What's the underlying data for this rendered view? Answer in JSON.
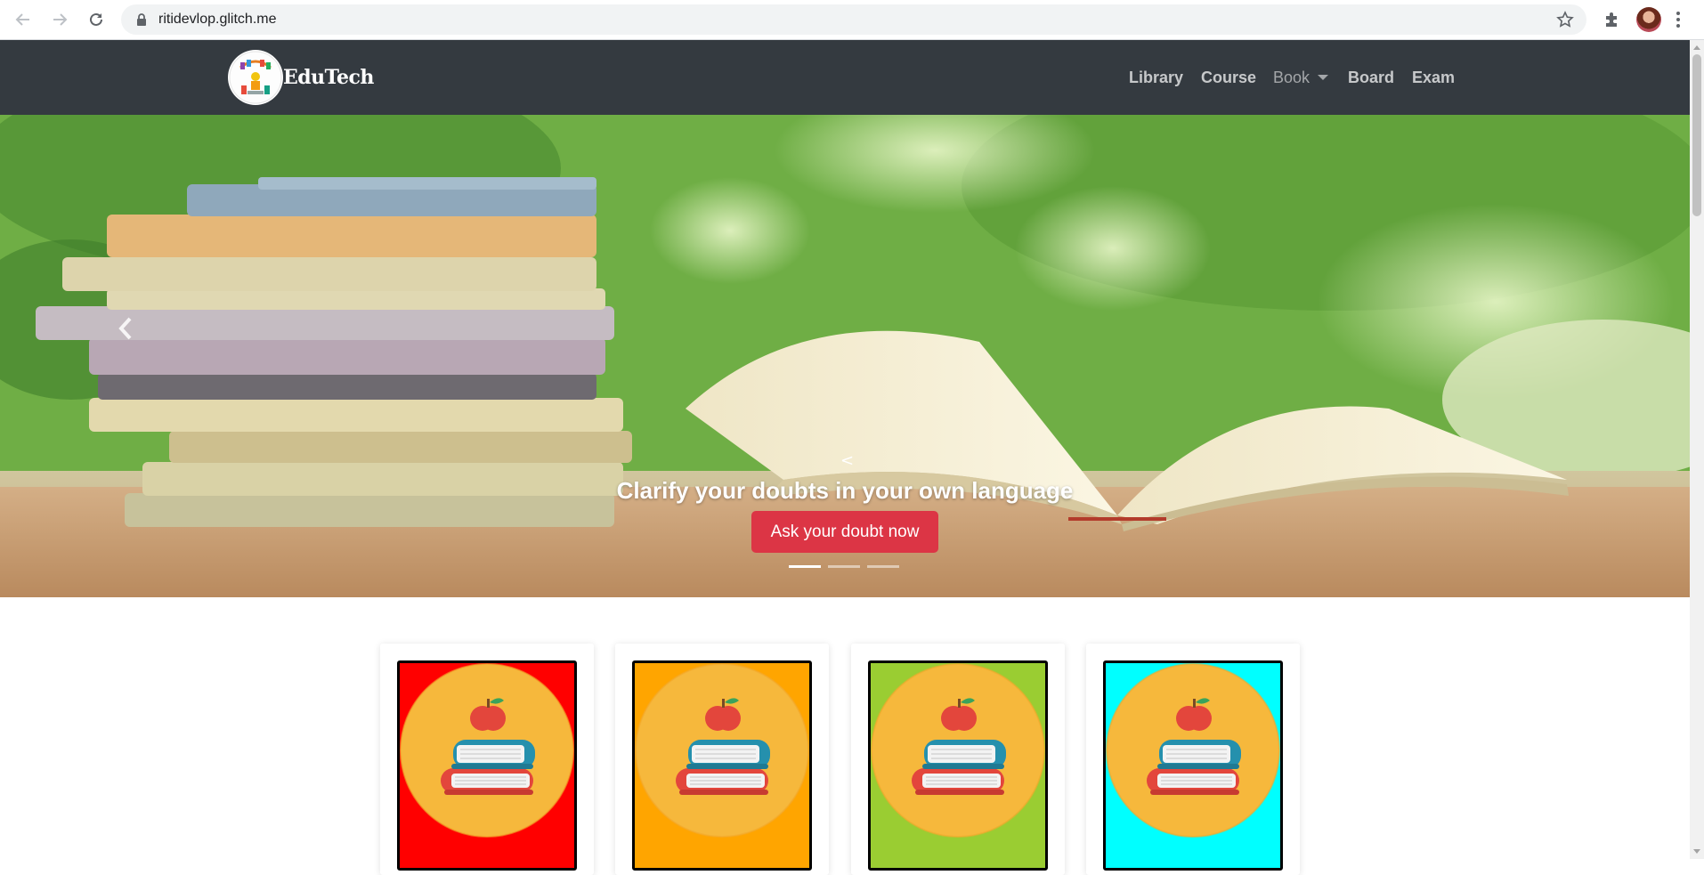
{
  "browser": {
    "url": "ritidevlop.glitch.me",
    "icons": [
      "back-arrow-icon",
      "forward-arrow-icon",
      "reload-icon",
      "lock-icon",
      "star-icon",
      "puzzle-icon",
      "kebab-menu-icon"
    ]
  },
  "navbar": {
    "brand": "EduTech",
    "links": [
      {
        "label": "Library"
      },
      {
        "label": "Course"
      },
      {
        "label": "Book",
        "dropdown": true
      },
      {
        "label": "Board"
      },
      {
        "label": "Exam"
      }
    ],
    "background": "#343a40"
  },
  "hero": {
    "arrow_text": "<",
    "caption": "Clarify your doubts in your own language",
    "button": "Ask your doubt now",
    "button_color": "#dc3545",
    "slide_count": 3,
    "active_slide": 1
  },
  "cards": [
    {
      "color": "#ff0000"
    },
    {
      "color": "#ffa500"
    },
    {
      "color": "#9acd32"
    },
    {
      "color": "#00ffff"
    }
  ]
}
